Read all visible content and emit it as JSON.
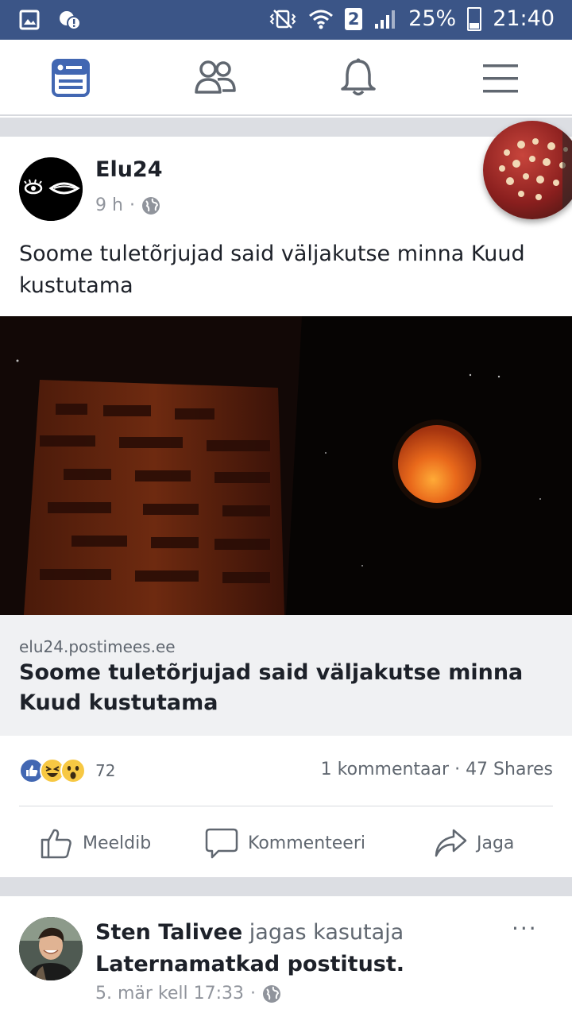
{
  "status_bar": {
    "battery": "25%",
    "time": "21:40",
    "sim": "2"
  },
  "nav": {
    "items": [
      "news-feed",
      "friends",
      "notifications",
      "menu"
    ]
  },
  "post1": {
    "author": "Elu24",
    "time": "9 h",
    "separator": "·",
    "text": "Soome tuletõrjujad said väljakutse minna Kuud kustutama",
    "link": {
      "domain": "elu24.postimees.ee",
      "title": "Soome tuletõrjujad said väljakutse minna Kuud kustutama"
    },
    "reaction_count": "72",
    "comments": "1 kommentaar",
    "shares": "47 Shares",
    "share_separator": "·",
    "actions": {
      "like": "Meeldib",
      "comment": "Kommenteeri",
      "share": "Jaga"
    }
  },
  "post2": {
    "author": "Sten Talivee",
    "shared_text": "jagas kasutaja",
    "shared_page": "Laternamatkad postitust.",
    "time": "5. mär kell 17:33",
    "separator": "·",
    "more": "···"
  },
  "colors": {
    "header": "#3b5587",
    "accent": "#4267b2",
    "separator": "#dcdee3"
  }
}
